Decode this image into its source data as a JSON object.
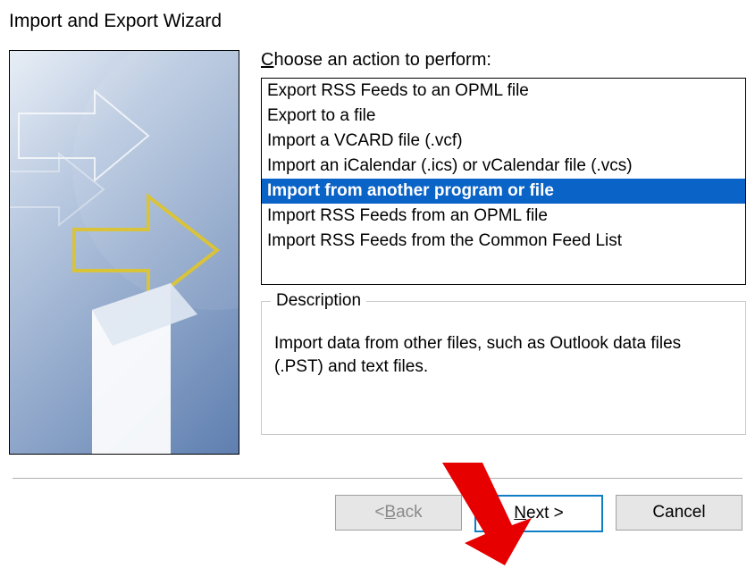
{
  "title": "Import and Export Wizard",
  "prompt_pre": "C",
  "prompt_post": "hoose an action to perform:",
  "actions": [
    "Export RSS Feeds to an OPML file",
    "Export to a file",
    "Import a VCARD file (.vcf)",
    "Import an iCalendar (.ics) or vCalendar file (.vcs)",
    "Import from another program or file",
    "Import RSS Feeds from an OPML file",
    "Import RSS Feeds from the Common Feed List"
  ],
  "selected_index": 4,
  "description_legend": "Description",
  "description_text": "Import data from other files, such as Outlook data files (.PST) and text files.",
  "buttons": {
    "back_pre": "< ",
    "back_accel": "B",
    "back_post": "ack",
    "next_accel": "N",
    "next_post": "ext >",
    "cancel": "Cancel"
  }
}
